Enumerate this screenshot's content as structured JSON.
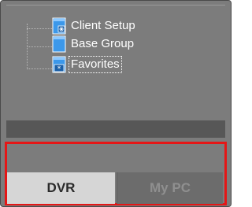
{
  "tree": {
    "items": [
      {
        "label": "Client Setup",
        "icon": "client-setup-icon"
      },
      {
        "label": "Base Group",
        "icon": "folder-icon"
      },
      {
        "label": "Favorites",
        "icon": "favorites-icon",
        "selected": true
      }
    ]
  },
  "tabs": {
    "dvr_label": "DVR",
    "mypc_label": "My PC",
    "active": "DVR"
  },
  "colors": {
    "highlight_border": "#e51616",
    "icon_blue": "#2f8fe6"
  }
}
